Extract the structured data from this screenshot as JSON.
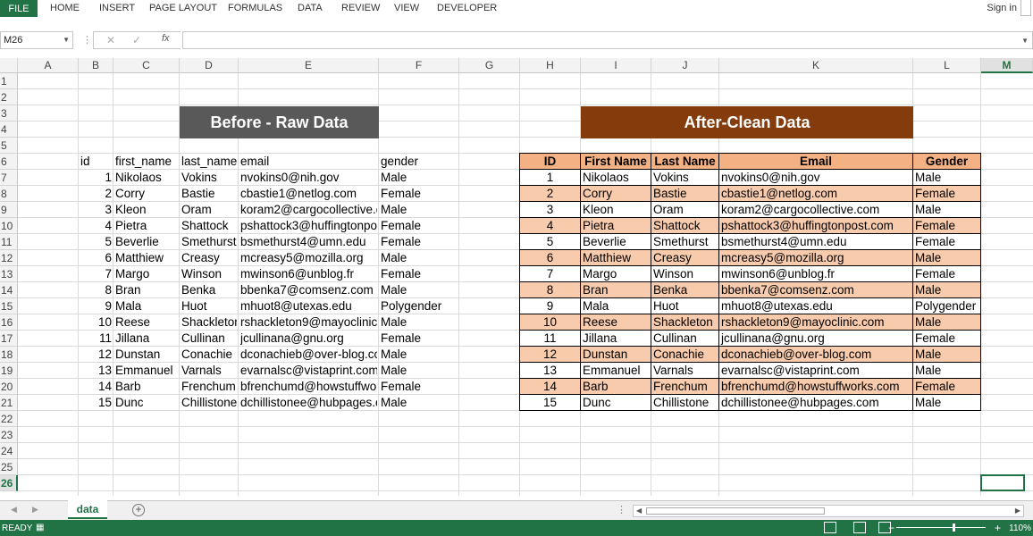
{
  "ribbon": {
    "file": "FILE",
    "tabs": [
      "HOME",
      "INSERT",
      "PAGE LAYOUT",
      "FORMULAS",
      "DATA",
      "REVIEW",
      "VIEW",
      "DEVELOPER"
    ],
    "signin": "Sign in"
  },
  "formula_bar": {
    "name_box": "M26",
    "fx": "fx",
    "value": ""
  },
  "columns": [
    "A",
    "B",
    "C",
    "D",
    "E",
    "F",
    "G",
    "H",
    "I",
    "J",
    "K",
    "L",
    "M"
  ],
  "rows": [
    "1",
    "2",
    "3",
    "4",
    "5",
    "6",
    "7",
    "8",
    "9",
    "10",
    "11",
    "12",
    "13",
    "14",
    "15",
    "16",
    "17",
    "18",
    "19",
    "20",
    "21",
    "22",
    "23",
    "24",
    "25",
    "26"
  ],
  "selected": {
    "column": "M",
    "row": "26"
  },
  "raw": {
    "banner": "Before - Raw Data",
    "headers": [
      "id",
      "first_name",
      "last_name",
      "email",
      "gender"
    ],
    "rows": [
      [
        "1",
        "Nikolaos",
        "Vokins",
        "nvokins0@nih.gov",
        "Male"
      ],
      [
        "2",
        "Corry",
        "Bastie",
        "cbastie1@netlog.com",
        "Female"
      ],
      [
        "3",
        "Kleon",
        "Oram",
        "koram2@cargocollective.c",
        "Male"
      ],
      [
        "4",
        "Pietra",
        "Shattock",
        "pshattock3@huffingtonpos",
        "Female"
      ],
      [
        "5",
        "Beverlie",
        "Smethurst",
        "bsmethurst4@umn.edu",
        "Female"
      ],
      [
        "6",
        "Matthiew",
        "Creasy",
        "mcreasy5@mozilla.org",
        "Male"
      ],
      [
        "7",
        "Margo",
        "Winson",
        "mwinson6@unblog.fr",
        "Female"
      ],
      [
        "8",
        "Bran",
        "Benka",
        "bbenka7@comsenz.com",
        "Male"
      ],
      [
        "9",
        "Mala",
        "Huot",
        "mhuot8@utexas.edu",
        "Polygender"
      ],
      [
        "10",
        "Reese",
        "Shackleton",
        "rshackleton9@mayoclinic.",
        "Male"
      ],
      [
        "11",
        "Jillana",
        "Cullinan",
        "jcullinana@gnu.org",
        "Female"
      ],
      [
        "12",
        "Dunstan",
        "Conachie",
        "dconachieb@over-blog.cc",
        "Male"
      ],
      [
        "13",
        "Emmanuel",
        "Varnals",
        "evarnalsc@vistaprint.com",
        "Male"
      ],
      [
        "14",
        "Barb",
        "Frenchum",
        "bfrenchumd@howstuffwor",
        "Female"
      ],
      [
        "15",
        "Dunc",
        "Chillistone",
        "dchillistonee@hubpages.c",
        "Male"
      ]
    ]
  },
  "clean": {
    "banner": "After-Clean Data",
    "headers": [
      "ID",
      "First Name",
      "Last Name",
      "Email",
      "Gender"
    ],
    "rows": [
      [
        "1",
        "Nikolaos",
        "Vokins",
        "nvokins0@nih.gov",
        "Male"
      ],
      [
        "2",
        "Corry",
        "Bastie",
        "cbastie1@netlog.com",
        "Female"
      ],
      [
        "3",
        "Kleon",
        "Oram",
        "koram2@cargocollective.com",
        "Male"
      ],
      [
        "4",
        "Pietra",
        "Shattock",
        "pshattock3@huffingtonpost.com",
        "Female"
      ],
      [
        "5",
        "Beverlie",
        "Smethurst",
        "bsmethurst4@umn.edu",
        "Female"
      ],
      [
        "6",
        "Matthiew",
        "Creasy",
        "mcreasy5@mozilla.org",
        "Male"
      ],
      [
        "7",
        "Margo",
        "Winson",
        "mwinson6@unblog.fr",
        "Female"
      ],
      [
        "8",
        "Bran",
        "Benka",
        "bbenka7@comsenz.com",
        "Male"
      ],
      [
        "9",
        "Mala",
        "Huot",
        "mhuot8@utexas.edu",
        "Polygender"
      ],
      [
        "10",
        "Reese",
        "Shackleton",
        "rshackleton9@mayoclinic.com",
        "Male"
      ],
      [
        "11",
        "Jillana",
        "Cullinan",
        "jcullinana@gnu.org",
        "Female"
      ],
      [
        "12",
        "Dunstan",
        "Conachie",
        "dconachieb@over-blog.com",
        "Male"
      ],
      [
        "13",
        "Emmanuel",
        "Varnals",
        "evarnalsc@vistaprint.com",
        "Male"
      ],
      [
        "14",
        "Barb",
        "Frenchum",
        "bfrenchumd@howstuffworks.com",
        "Female"
      ],
      [
        "15",
        "Dunc",
        "Chillistone",
        "dchillistonee@hubpages.com",
        "Male"
      ]
    ]
  },
  "colors": {
    "accent": "#217346",
    "raw_banner": "#595959",
    "clean_banner": "#843c0c",
    "header_fill": "#f4b183",
    "band_fill": "#f8cbad"
  },
  "sheet_tab": "data",
  "add_sheet": "+",
  "status": {
    "ready": "READY",
    "zoom": "110%"
  },
  "icons": [
    "name-box-dropdown-icon",
    "cancel-icon",
    "enter-icon",
    "function-icon",
    "add-sheet-icon",
    "normal-view-icon",
    "page-layout-icon",
    "page-break-icon"
  ]
}
